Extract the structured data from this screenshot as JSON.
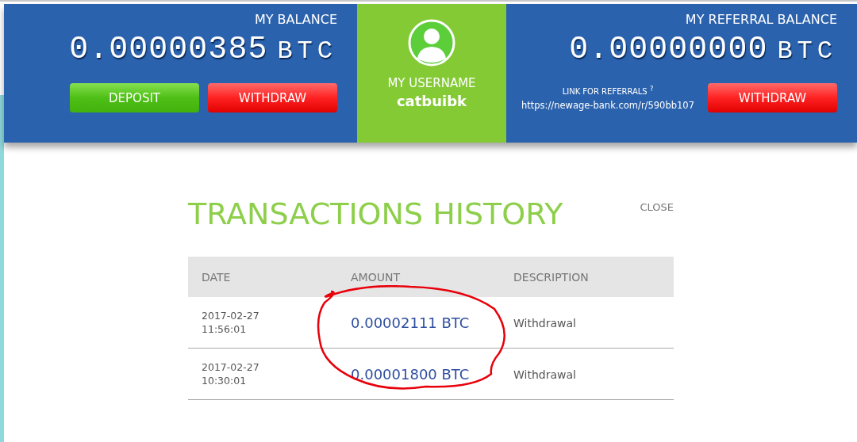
{
  "balance": {
    "label": "MY BALANCE",
    "amount": "0.00000385",
    "unit": "BTC",
    "buttons": [
      {
        "label": "DEPOSIT",
        "kind": "deposit"
      },
      {
        "label": "WITHDRAW",
        "kind": "withdraw"
      }
    ]
  },
  "user": {
    "label": "MY USERNAME",
    "username": "catbuibk"
  },
  "referral": {
    "label": "MY REFERRAL BALANCE",
    "amount": "0.00000000",
    "unit": "BTC",
    "link_label": "LINK FOR REFERRALS $^{?}$",
    "link": "https://newage-bank.com/r/590bb107",
    "button": {
      "label": "WITHDRAW",
      "kind": "withdraw"
    }
  },
  "history": {
    "title": "TRANSACTIONS HISTORY",
    "close": "CLOSE",
    "columns": [
      "DATE",
      "AMOUNT",
      "DESCRIPTION"
    ],
    "rows": [
      {
        "date": "2017-02-27",
        "time": "11:56:01",
        "amount": "0.00002111 BTC",
        "description": "Withdrawal"
      },
      {
        "date": "2017-02-27",
        "time": "10:30:01",
        "amount": "0.00001800 BTC",
        "description": "Withdrawal"
      }
    ]
  }
}
